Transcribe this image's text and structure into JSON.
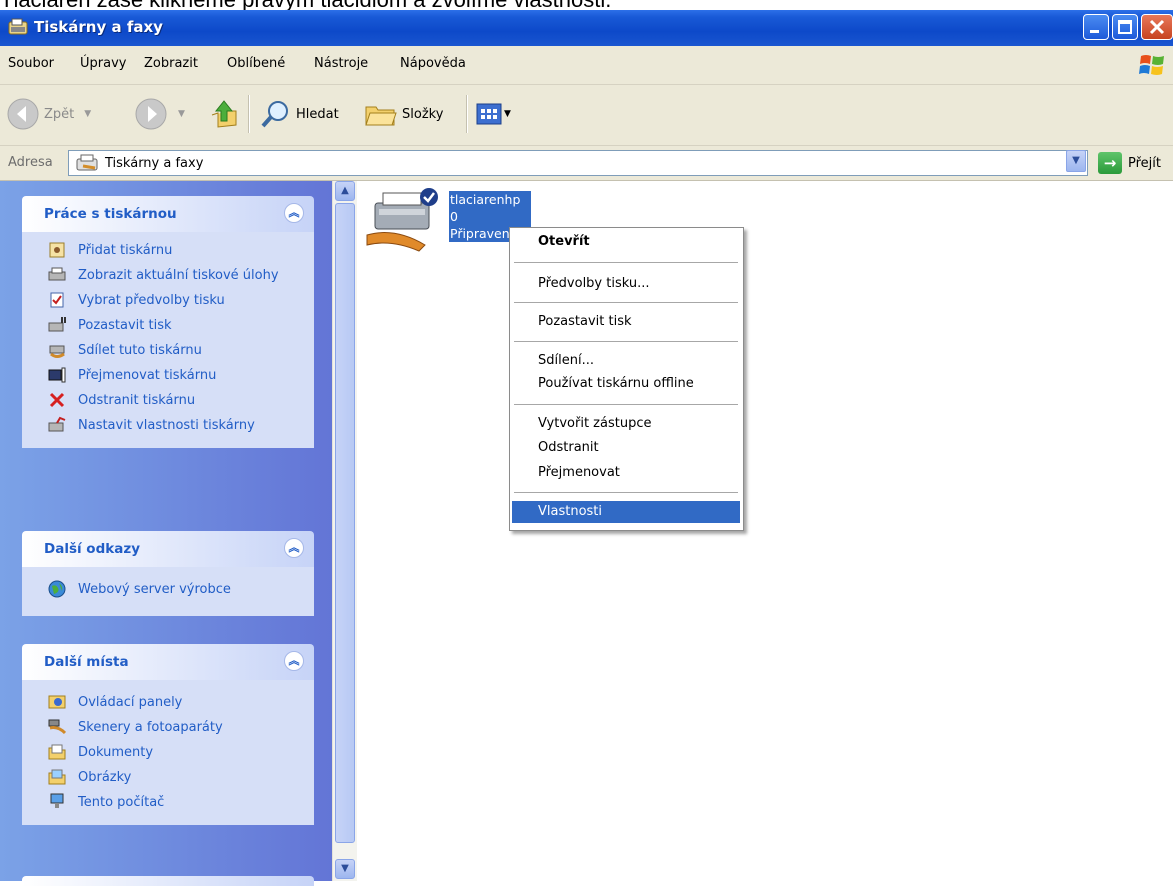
{
  "caption": "Tlačiareň zase klikneme pravým tlačidlom a zvolíme vlastnosti.",
  "window": {
    "title": "Tiskárny a faxy",
    "icon": "printers-folder-icon"
  },
  "menubar": {
    "items": [
      "Soubor",
      "Úpravy",
      "Zobrazit",
      "Oblíbené",
      "Nástroje",
      "Nápověda"
    ]
  },
  "toolbar": {
    "back_label": "Zpět",
    "search_label": "Hledat",
    "folders_label": "Složky"
  },
  "address": {
    "label": "Adresa",
    "value": "Tiskárny a faxy",
    "go_label": "Přejít"
  },
  "taskpane": {
    "panels": [
      {
        "title": "Práce s tiskárnou",
        "items": [
          {
            "label": "Přidat tiskárnu",
            "icon": "add-printer-icon"
          },
          {
            "label": "Zobrazit aktuální tiskové úlohy",
            "icon": "print-queue-icon"
          },
          {
            "label": "Vybrat předvolby tisku",
            "icon": "print-preferences-icon"
          },
          {
            "label": "Pozastavit tisk",
            "icon": "pause-printing-icon"
          },
          {
            "label": "Sdílet tuto tiskárnu",
            "icon": "share-printer-icon"
          },
          {
            "label": "Přejmenovat tiskárnu",
            "icon": "rename-icon"
          },
          {
            "label": "Odstranit tiskárnu",
            "icon": "delete-icon"
          },
          {
            "label": "Nastavit vlastnosti tiskárny",
            "icon": "printer-properties-icon"
          }
        ]
      },
      {
        "title": "Další odkazy",
        "items": [
          {
            "label": "Webový server výrobce",
            "icon": "globe-icon"
          }
        ]
      },
      {
        "title": "Další místa",
        "items": [
          {
            "label": "Ovládací panely",
            "icon": "control-panel-icon"
          },
          {
            "label": "Skenery a fotoaparáty",
            "icon": "scanner-icon"
          },
          {
            "label": "Dokumenty",
            "icon": "documents-folder-icon"
          },
          {
            "label": "Obrázky",
            "icon": "pictures-folder-icon"
          },
          {
            "label": "Tento počítač",
            "icon": "computer-icon"
          }
        ]
      }
    ]
  },
  "printer": {
    "name": "tlaciarenhp",
    "jobs": "0",
    "status": "Připraven"
  },
  "context_menu": {
    "items": [
      "Otevřít",
      "Předvolby tisku...",
      "Pozastavit tisk",
      "Sdílení...",
      "Používat tiskárnu offline",
      "Vytvořit zástupce",
      "Odstranit",
      "Přejmenovat",
      "Vlastnosti"
    ],
    "default_item": "Otevřít",
    "highlighted_item": "Vlastnosti"
  },
  "colors": {
    "titlebar": "#0d49c9",
    "selection": "#316ac5",
    "taskpane_link": "#215dc6"
  }
}
